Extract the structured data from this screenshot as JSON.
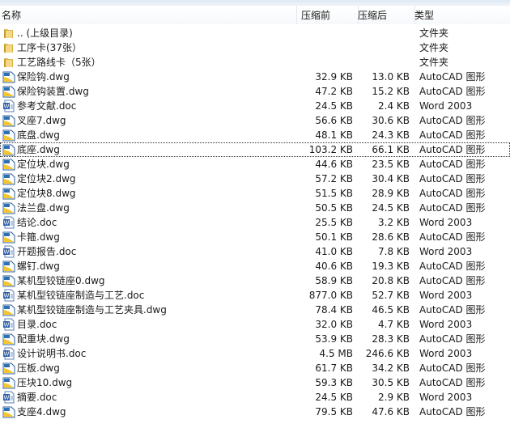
{
  "columns": {
    "name": "名称",
    "before": "压缩前",
    "after": "压缩后",
    "type": "类型"
  },
  "rows": [
    {
      "kind": "folder",
      "name": ".. (上级目录)",
      "before": "",
      "after": "",
      "type": "文件夹"
    },
    {
      "kind": "folder",
      "name": "工序卡(37张）",
      "before": "",
      "after": "",
      "type": "文件夹"
    },
    {
      "kind": "folder",
      "name": "工艺路线卡（5张）",
      "before": "",
      "after": "",
      "type": "文件夹"
    },
    {
      "kind": "dwg",
      "name": "保险钩.dwg",
      "before": "32.9 KB",
      "after": "13.0 KB",
      "type": "AutoCAD 图形"
    },
    {
      "kind": "dwg",
      "name": "保险钩装置.dwg",
      "before": "47.2 KB",
      "after": "15.2 KB",
      "type": "AutoCAD 图形"
    },
    {
      "kind": "doc",
      "name": "参考文献.doc",
      "before": "24.5 KB",
      "after": "2.4 KB",
      "type": "Word 2003"
    },
    {
      "kind": "dwg",
      "name": "叉座7.dwg",
      "before": "56.6 KB",
      "after": "30.6 KB",
      "type": "AutoCAD 图形"
    },
    {
      "kind": "dwg",
      "name": "底盘.dwg",
      "before": "48.1 KB",
      "after": "24.3 KB",
      "type": "AutoCAD 图形"
    },
    {
      "kind": "dwg",
      "name": "底座.dwg",
      "before": "103.2 KB",
      "after": "66.1 KB",
      "type": "AutoCAD 图形",
      "selected": true
    },
    {
      "kind": "dwg",
      "name": "定位块.dwg",
      "before": "44.6 KB",
      "after": "23.5 KB",
      "type": "AutoCAD 图形"
    },
    {
      "kind": "dwg",
      "name": "定位块2.dwg",
      "before": "57.2 KB",
      "after": "30.4 KB",
      "type": "AutoCAD 图形"
    },
    {
      "kind": "dwg",
      "name": "定位块8.dwg",
      "before": "51.5 KB",
      "after": "28.9 KB",
      "type": "AutoCAD 图形"
    },
    {
      "kind": "dwg",
      "name": "法兰盘.dwg",
      "before": "50.5 KB",
      "after": "24.5 KB",
      "type": "AutoCAD 图形"
    },
    {
      "kind": "doc",
      "name": "结论.doc",
      "before": "25.5 KB",
      "after": "3.2 KB",
      "type": "Word 2003"
    },
    {
      "kind": "dwg",
      "name": "卡箍.dwg",
      "before": "50.1 KB",
      "after": "28.6 KB",
      "type": "AutoCAD 图形"
    },
    {
      "kind": "doc",
      "name": "开题报告.doc",
      "before": "41.0 KB",
      "after": "7.8 KB",
      "type": "Word 2003"
    },
    {
      "kind": "dwg",
      "name": "螺钉.dwg",
      "before": "40.6 KB",
      "after": "19.3 KB",
      "type": "AutoCAD 图形"
    },
    {
      "kind": "dwg",
      "name": "某机型铰链座0.dwg",
      "before": "58.9 KB",
      "after": "20.8 KB",
      "type": "AutoCAD 图形"
    },
    {
      "kind": "doc",
      "name": "某机型铰链座制造与工艺.doc",
      "before": "877.0 KB",
      "after": "52.7 KB",
      "type": "Word 2003"
    },
    {
      "kind": "dwg",
      "name": "某机型铰链座制造与工艺夹具.dwg",
      "before": "78.4 KB",
      "after": "46.5 KB",
      "type": "AutoCAD 图形"
    },
    {
      "kind": "doc",
      "name": "目录.doc",
      "before": "32.0 KB",
      "after": "4.7 KB",
      "type": "Word 2003"
    },
    {
      "kind": "dwg",
      "name": "配重块.dwg",
      "before": "53.9 KB",
      "after": "28.3 KB",
      "type": "AutoCAD 图形"
    },
    {
      "kind": "doc",
      "name": "设计说明书.doc",
      "before": "4.5 MB",
      "after": "246.6 KB",
      "type": "Word 2003"
    },
    {
      "kind": "dwg",
      "name": "压板.dwg",
      "before": "61.7 KB",
      "after": "34.2 KB",
      "type": "AutoCAD 图形"
    },
    {
      "kind": "dwg",
      "name": "压块10.dwg",
      "before": "59.3 KB",
      "after": "30.5 KB",
      "type": "AutoCAD 图形"
    },
    {
      "kind": "doc",
      "name": "摘要.doc",
      "before": "24.5 KB",
      "after": "2.9 KB",
      "type": "Word 2003"
    },
    {
      "kind": "dwg",
      "name": "支座4.dwg",
      "before": "79.5 KB",
      "after": "47.6 KB",
      "type": "AutoCAD 图形"
    }
  ]
}
